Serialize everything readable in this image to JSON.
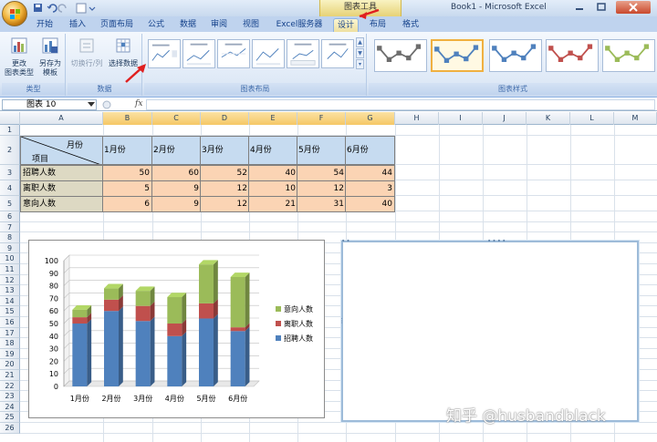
{
  "app": {
    "title": "Book1 - Microsoft Excel",
    "contextual_tool": "图表工具"
  },
  "tabs": [
    {
      "label": "开始"
    },
    {
      "label": "插入"
    },
    {
      "label": "页面布局"
    },
    {
      "label": "公式"
    },
    {
      "label": "数据"
    },
    {
      "label": "审阅"
    },
    {
      "label": "视图"
    },
    {
      "label": "Excel服务器"
    },
    {
      "label": "设计"
    },
    {
      "label": "布局"
    },
    {
      "label": "格式"
    }
  ],
  "ribbon": {
    "groups": {
      "type": {
        "label": "类型",
        "change_type": "更改\n图表类型",
        "change_type_l1": "更改",
        "change_type_l2": "图表类型",
        "save_template_l1": "另存为",
        "save_template_l2": "模板"
      },
      "data": {
        "label": "数据",
        "switch_row_col": "切换行/列",
        "select_data": "选择数据"
      },
      "layouts": {
        "label": "图表布局"
      },
      "styles": {
        "label": "图表样式"
      }
    }
  },
  "formula_bar": {
    "name_box": "图表 10",
    "fx": "fx",
    "formula": ""
  },
  "sheet": {
    "columns": [
      "A",
      "B",
      "C",
      "D",
      "E",
      "F",
      "G",
      "H",
      "I",
      "J",
      "K",
      "L",
      "M"
    ],
    "rows": [
      "1",
      "2",
      "3",
      "4",
      "5",
      "6",
      "7",
      "8",
      "9",
      "10",
      "11",
      "12",
      "13",
      "14",
      "15",
      "16",
      "17",
      "18",
      "19",
      "20",
      "21",
      "22",
      "23",
      "24",
      "25",
      "26"
    ],
    "table": {
      "corner_top": "月份",
      "corner_bottom": "项目",
      "months": [
        "1月份",
        "2月份",
        "3月份",
        "4月份",
        "5月份",
        "6月份"
      ],
      "rows": [
        {
          "label": "招聘人数",
          "values": [
            "50",
            "60",
            "52",
            "40",
            "54",
            "44"
          ]
        },
        {
          "label": "离职人数",
          "values": [
            "5",
            "9",
            "12",
            "10",
            "12",
            "3"
          ]
        },
        {
          "label": "意向人数",
          "values": [
            "6",
            "9",
            "12",
            "21",
            "31",
            "40"
          ]
        }
      ]
    }
  },
  "chart_data": {
    "type": "bar",
    "stacked": true,
    "three_d": true,
    "categories": [
      "1月份",
      "2月份",
      "3月份",
      "4月份",
      "5月份",
      "6月份"
    ],
    "series": [
      {
        "name": "招聘人数",
        "values": [
          50,
          60,
          52,
          40,
          54,
          44
        ],
        "color": "#4f81bd"
      },
      {
        "name": "离职人数",
        "values": [
          5,
          9,
          12,
          10,
          12,
          3
        ],
        "color": "#c0504d"
      },
      {
        "name": "意向人数",
        "values": [
          6,
          9,
          12,
          21,
          31,
          40
        ],
        "color": "#9bbb59"
      }
    ],
    "ylim": [
      0,
      100
    ],
    "yticks": [
      "0",
      "10",
      "20",
      "30",
      "40",
      "50",
      "60",
      "70",
      "80",
      "90",
      "100"
    ],
    "legend_position": "right",
    "grid": true
  },
  "watermark": {
    "text": "知乎 @husbandblack"
  },
  "colors": {
    "header_fill": "#c6dbf0",
    "label_fill": "#ddd9c3",
    "value_fill": "#fbd4b4",
    "annotation_arrow": "#e02020"
  }
}
